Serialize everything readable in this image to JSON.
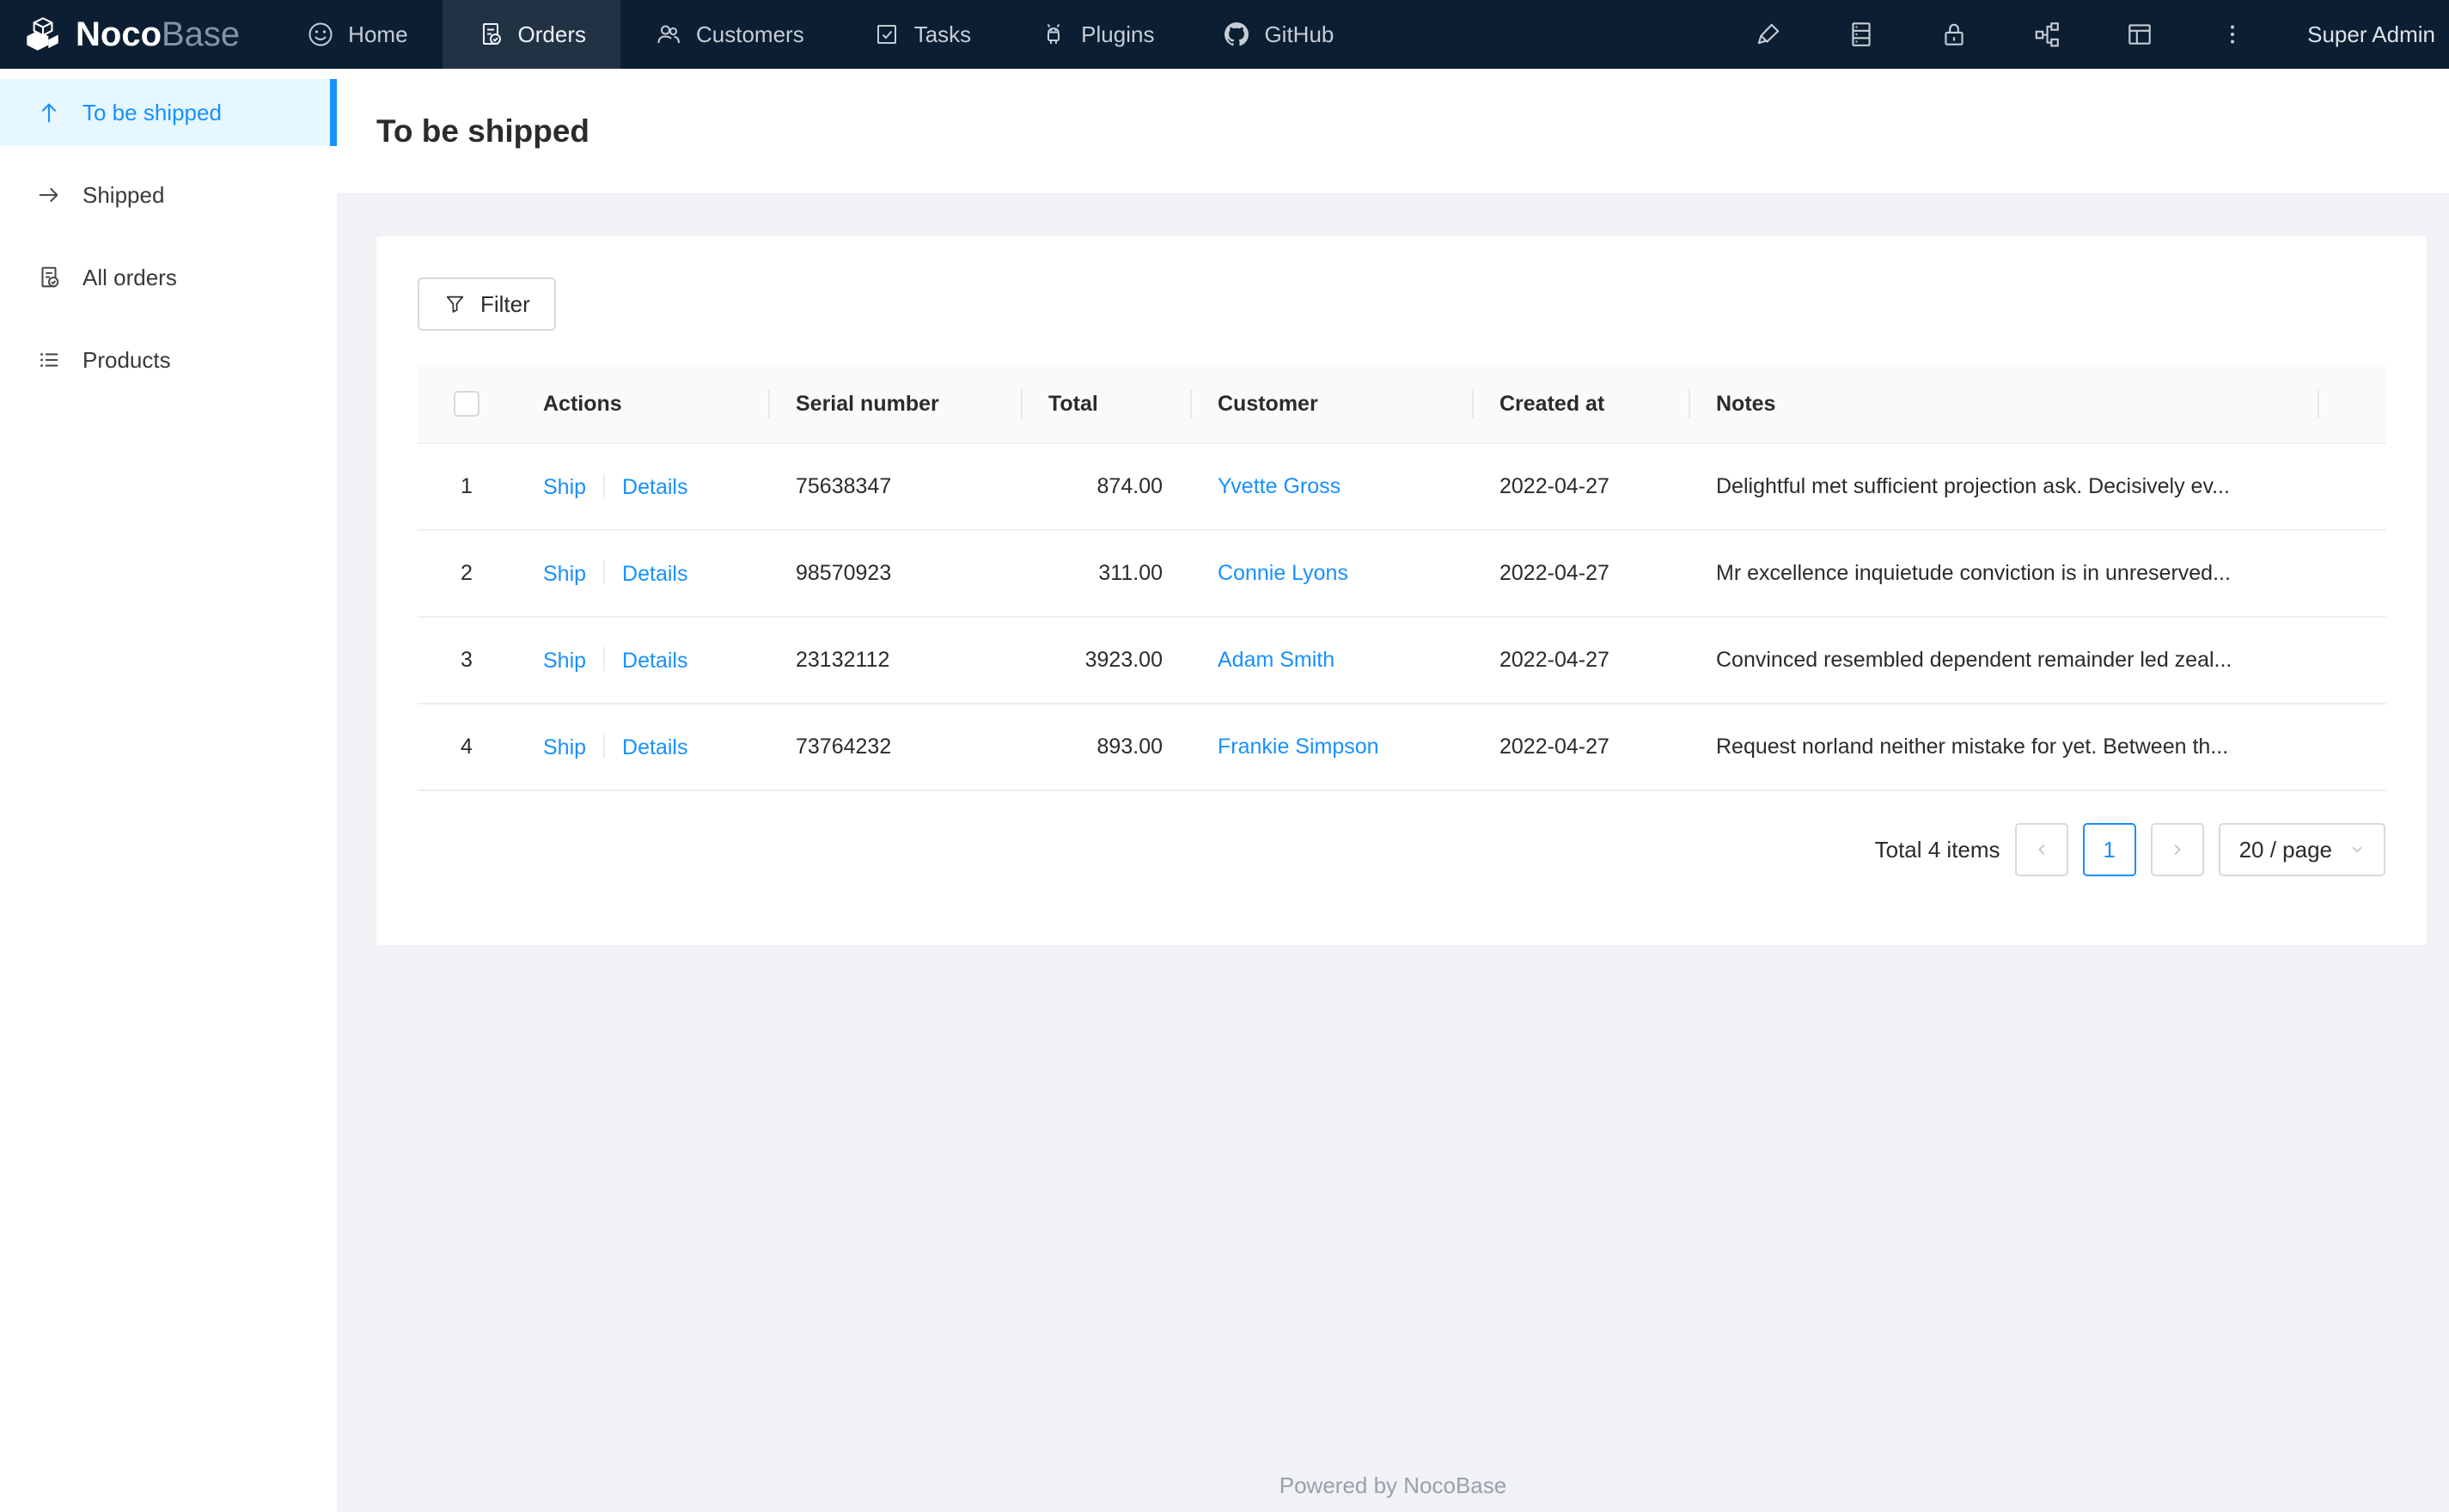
{
  "navbar": {
    "brand": {
      "bold": "Noco",
      "light": "Base"
    },
    "items": [
      {
        "label": "Home"
      },
      {
        "label": "Orders"
      },
      {
        "label": "Customers"
      },
      {
        "label": "Tasks"
      },
      {
        "label": "Plugins"
      },
      {
        "label": "GitHub"
      }
    ],
    "user": "Super Admin"
  },
  "sidebar": {
    "items": [
      {
        "label": "To be shipped"
      },
      {
        "label": "Shipped"
      },
      {
        "label": "All orders"
      },
      {
        "label": "Products"
      }
    ]
  },
  "page": {
    "title": "To be shipped"
  },
  "toolbar": {
    "filter_label": "Filter"
  },
  "table": {
    "columns": {
      "actions": "Actions",
      "serial": "Serial number",
      "total": "Total",
      "customer": "Customer",
      "created": "Created at",
      "notes": "Notes"
    },
    "action_labels": {
      "ship": "Ship",
      "details": "Details"
    },
    "rows": [
      {
        "index": "1",
        "serial": "75638347",
        "total": "874.00",
        "customer": "Yvette Gross",
        "created_at": "2022-04-27",
        "notes": "Delightful met sufficient projection ask. Decisively ev..."
      },
      {
        "index": "2",
        "serial": "98570923",
        "total": "311.00",
        "customer": "Connie Lyons",
        "created_at": "2022-04-27",
        "notes": "Mr excellence inquietude conviction is in unreserved..."
      },
      {
        "index": "3",
        "serial": "23132112",
        "total": "3923.00",
        "customer": "Adam Smith",
        "created_at": "2022-04-27",
        "notes": "Convinced resembled dependent remainder led zeal..."
      },
      {
        "index": "4",
        "serial": "73764232",
        "total": "893.00",
        "customer": "Frankie Simpson",
        "created_at": "2022-04-27",
        "notes": "Request norland neither mistake for yet. Between th..."
      }
    ]
  },
  "pagination": {
    "total_text": "Total 4 items",
    "current_page": "1",
    "page_size": "20 / page"
  },
  "footer": {
    "text": "Powered by NocoBase"
  },
  "colors": {
    "accent": "#1890ff",
    "navbar_bg": "#0c1e32",
    "sidebar_active_bg": "#e6f7ff",
    "page_bg": "#f0f2f5",
    "table_header_bg": "#fafafa",
    "border": "#f0f0f0"
  },
  "icons": [
    "box-logo-icon",
    "smile-icon",
    "file-done-icon",
    "team-icon",
    "check-square-icon",
    "android-icon",
    "github-icon",
    "highlight-icon",
    "database-icon",
    "lock-icon",
    "apartment-icon",
    "layout-icon",
    "more-vertical-icon",
    "arrow-up-icon",
    "arrow-right-icon",
    "unordered-list-icon",
    "filter-icon",
    "chevron-left-icon",
    "chevron-right-icon",
    "chevron-down-icon"
  ]
}
